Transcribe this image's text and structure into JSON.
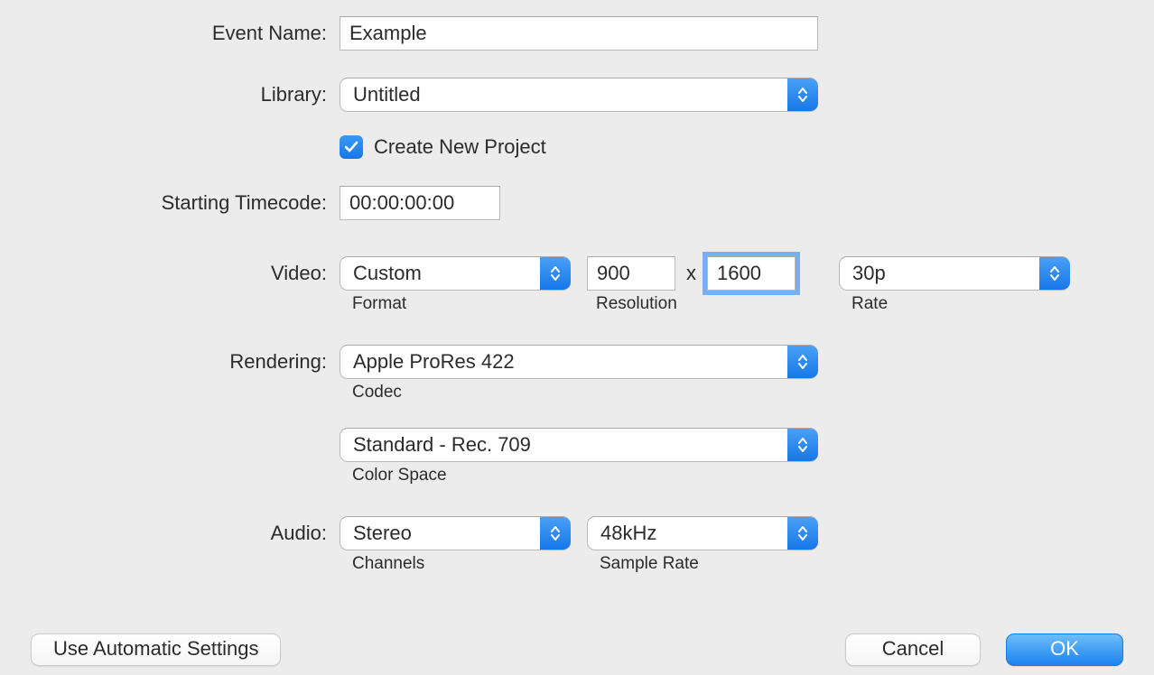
{
  "labels": {
    "event_name": "Event Name:",
    "library": "Library:",
    "starting_timecode": "Starting Timecode:",
    "video": "Video:",
    "rendering": "Rendering:",
    "audio": "Audio:"
  },
  "event_name_value": "Example",
  "library_value": "Untitled",
  "create_new_project": {
    "checked": true,
    "label": "Create New Project"
  },
  "starting_timecode": "00:00:00:00",
  "video": {
    "format_value": "Custom",
    "format_caption": "Format",
    "resolution_w": "900",
    "resolution_h": "1600",
    "resolution_caption": "Resolution",
    "resolution_sep": "x",
    "rate_value": "30p",
    "rate_caption": "Rate"
  },
  "rendering": {
    "codec_value": "Apple ProRes 422",
    "codec_caption": "Codec",
    "color_space_value": "Standard - Rec. 709",
    "color_space_caption": "Color Space"
  },
  "audio": {
    "channels_value": "Stereo",
    "channels_caption": "Channels",
    "sample_rate_value": "48kHz",
    "sample_rate_caption": "Sample Rate"
  },
  "buttons": {
    "auto": "Use Automatic Settings",
    "cancel": "Cancel",
    "ok": "OK"
  }
}
